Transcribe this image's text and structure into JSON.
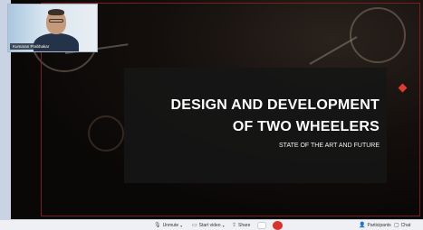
{
  "participant": {
    "name": "Kumaran Prabhakar"
  },
  "slide": {
    "title_line1": "DESIGN AND DEVELOPMENT",
    "title_line2": "OF TWO WHEELERS",
    "subtitle": "STATE OF THE ART AND FUTURE"
  },
  "toolbar": {
    "unmute_label": "Unmute",
    "start_video_label": "Start video",
    "share_label": "Share",
    "participants_label": "Participants",
    "chat_label": "Chat"
  },
  "colors": {
    "end_call": "#d9342b",
    "slide_bg": "#0a0807",
    "accent_dot": "#e03b2f"
  }
}
